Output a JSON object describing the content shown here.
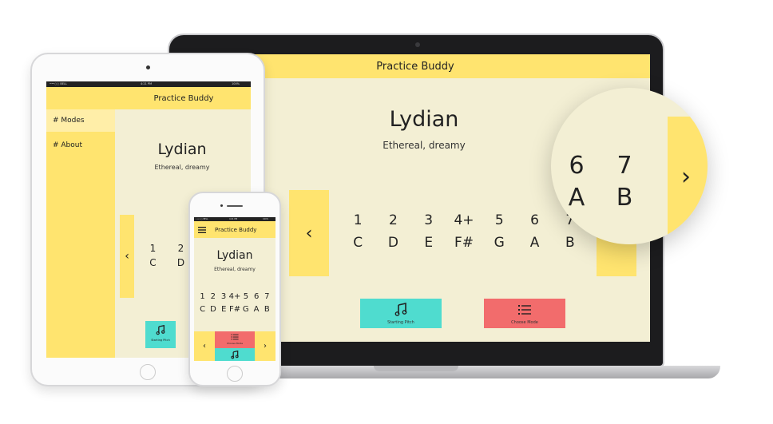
{
  "app": {
    "title": "Practice Buddy"
  },
  "mode": {
    "name": "Lydian",
    "description": "Ethereal, dreamy"
  },
  "scale": {
    "degrees": [
      "1",
      "2",
      "3",
      "4+",
      "5",
      "6",
      "7"
    ],
    "notes": [
      "C",
      "D",
      "E",
      "F#",
      "G",
      "A",
      "B"
    ]
  },
  "nav": {
    "prev": "‹",
    "next": "›"
  },
  "buttons": {
    "starting_pitch": "Starting Pitch",
    "choose_mode": "Choose Mode"
  },
  "sidebar": {
    "items": [
      {
        "label": "# Modes",
        "active": true
      },
      {
        "label": "# About",
        "active": false
      }
    ]
  },
  "status_bar": {
    "carrier": "•••○○ BELL",
    "time": "4:21 PM",
    "battery": "100%"
  },
  "colors": {
    "yellow": "#ffe46f",
    "cream": "#f3efd4",
    "teal": "#4fdccf",
    "red": "#f26c6c"
  },
  "icons": {
    "pitch": "music-note-icon",
    "mode": "list-icon",
    "menu": "hamburger-menu-icon"
  }
}
